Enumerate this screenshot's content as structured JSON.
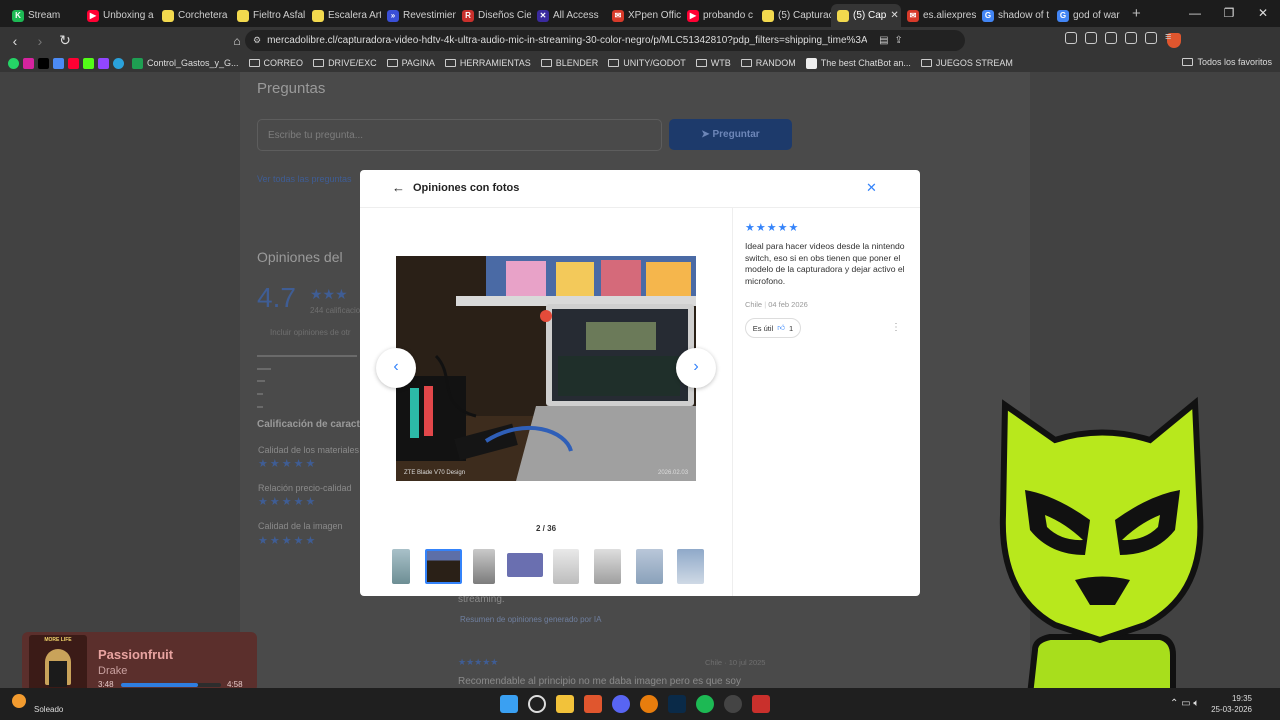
{
  "browser": {
    "tabs": [
      {
        "label": "Stream",
        "color": "#1db954",
        "glyph": "K"
      },
      {
        "label": "Unboxing a",
        "color": "#ff0033",
        "glyph": "▶"
      },
      {
        "label": "Corchetera",
        "color": "#f2d94e",
        "glyph": ""
      },
      {
        "label": "Fieltro Asfal",
        "color": "#f2d94e",
        "glyph": ""
      },
      {
        "label": "Escalera Art",
        "color": "#f2d94e",
        "glyph": ""
      },
      {
        "label": "Revestimien",
        "color": "#3a4fd6",
        "glyph": "»"
      },
      {
        "label": "Diseños Cie",
        "color": "#c9302c",
        "glyph": "R"
      },
      {
        "label": "All Access",
        "color": "#3a2a9e",
        "glyph": "✕"
      },
      {
        "label": "XPpen Offic",
        "color": "#d73a2a",
        "glyph": "✉"
      },
      {
        "label": "probando c",
        "color": "#ff0033",
        "glyph": "▶"
      },
      {
        "label": "(5) Capturac",
        "color": "#f2d94e",
        "glyph": ""
      },
      {
        "label": "(5) Cap",
        "color": "#f2d94e",
        "glyph": "",
        "active": true
      },
      {
        "label": "es.aliexpres",
        "color": "#d73a2a",
        "glyph": "✉"
      },
      {
        "label": "shadow of t",
        "color": "#4285f4",
        "glyph": "G"
      },
      {
        "label": "god of war",
        "color": "#4285f4",
        "glyph": "G"
      }
    ],
    "new_tab": "+",
    "url": "mercadolibre.cl/capturadora-video-hdtv-4k-ultra-audio-mic-in-streaming-30-color-negro/p/MLC51342810?pdp_filters=shipping_time%3Anext...",
    "bookmarks": [
      {
        "label": "Control_Gastos_y_G...",
        "type": "icon",
        "color": "#1e9e52"
      },
      {
        "label": "CORREO",
        "type": "folder"
      },
      {
        "label": "DRIVE/EXC",
        "type": "folder"
      },
      {
        "label": "PAGINA",
        "type": "folder"
      },
      {
        "label": "HERRAMIENTAS",
        "type": "folder"
      },
      {
        "label": "BLENDER",
        "type": "folder"
      },
      {
        "label": "UNITY/GODOT",
        "type": "folder"
      },
      {
        "label": "WTB",
        "type": "folder"
      },
      {
        "label": "RANDOM",
        "type": "folder"
      },
      {
        "label": "The best ChatBot an...",
        "type": "icon",
        "color": "#eeeeee"
      },
      {
        "label": "JUEGOS STREAM",
        "type": "folder"
      }
    ],
    "all_favorites": "Todos los favoritos"
  },
  "page": {
    "questions_title": "Preguntas",
    "question_placeholder": "Escribe tu pregunta...",
    "ask_button": "Preguntar",
    "see_all_questions": "Ver todas las preguntas",
    "opinions_title": "Opiniones del",
    "rating": "4.7",
    "rating_count": "244 calificaciones",
    "include_reviews": "Incluir opiniones de otr",
    "features_title": "Calificación de caract",
    "criteria": [
      {
        "label": "Calidad de los materiales",
        "stars": "★★★★★"
      },
      {
        "label": "Relación precio-calidad",
        "stars": "★★★★★"
      },
      {
        "label": "Calidad de la imagen",
        "stars": "★★★★★"
      }
    ],
    "streaming_text": "streaming.",
    "summary_text": "Resumen de opiniones generado por IA",
    "bottom_stars": "★★★★★",
    "bottom_meta": "Chile · 10 jul 2025",
    "bottom_review": "Recomendable al principio no me daba imagen pero es que soy"
  },
  "modal": {
    "title": "Opiniones con fotos",
    "counter": "2 / 36",
    "photo_caption": "ZTE Blade V70 Design",
    "photo_date": "2026.02.03",
    "review": {
      "stars": "★★★★★",
      "text": "Ideal para hacer videos desde la nintendo switch, eso si en obs tienen que poner el modelo de la capturadora y dejar activo el microfono.",
      "country": "Chile",
      "date": "04 feb 2026",
      "useful_label": "Es útil",
      "useful_count": "1"
    }
  },
  "music": {
    "song": "Passionfruit",
    "artist": "Drake",
    "elapsed": "3:48",
    "duration": "4:58",
    "progress": 0.77,
    "album_text": "MORE LIFE"
  },
  "taskbar": {
    "weather": "Soleado",
    "time": "19:35",
    "date": "25-03-2026"
  }
}
